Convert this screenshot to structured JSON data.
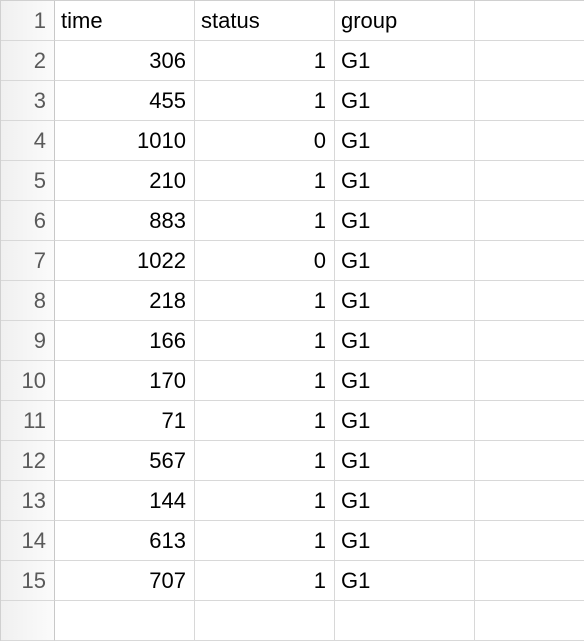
{
  "headers": {
    "col1": "time",
    "col2": "status",
    "col3": "group"
  },
  "rows": [
    {
      "n": "1",
      "time": "",
      "status": "",
      "group": ""
    },
    {
      "n": "2",
      "time": "306",
      "status": "1",
      "group": "G1"
    },
    {
      "n": "3",
      "time": "455",
      "status": "1",
      "group": "G1"
    },
    {
      "n": "4",
      "time": "1010",
      "status": "0",
      "group": "G1"
    },
    {
      "n": "5",
      "time": "210",
      "status": "1",
      "group": "G1"
    },
    {
      "n": "6",
      "time": "883",
      "status": "1",
      "group": "G1"
    },
    {
      "n": "7",
      "time": "1022",
      "status": "0",
      "group": "G1"
    },
    {
      "n": "8",
      "time": "218",
      "status": "1",
      "group": "G1"
    },
    {
      "n": "9",
      "time": "166",
      "status": "1",
      "group": "G1"
    },
    {
      "n": "10",
      "time": "170",
      "status": "1",
      "group": "G1"
    },
    {
      "n": "11",
      "time": "71",
      "status": "1",
      "group": "G1"
    },
    {
      "n": "12",
      "time": "567",
      "status": "1",
      "group": "G1"
    },
    {
      "n": "13",
      "time": "144",
      "status": "1",
      "group": "G1"
    },
    {
      "n": "14",
      "time": "613",
      "status": "1",
      "group": "G1"
    },
    {
      "n": "15",
      "time": "707",
      "status": "1",
      "group": "G1"
    }
  ],
  "chart_data": {
    "type": "table",
    "columns": [
      "time",
      "status",
      "group"
    ],
    "data": [
      [
        306,
        1,
        "G1"
      ],
      [
        455,
        1,
        "G1"
      ],
      [
        1010,
        0,
        "G1"
      ],
      [
        210,
        1,
        "G1"
      ],
      [
        883,
        1,
        "G1"
      ],
      [
        1022,
        0,
        "G1"
      ],
      [
        218,
        1,
        "G1"
      ],
      [
        166,
        1,
        "G1"
      ],
      [
        170,
        1,
        "G1"
      ],
      [
        71,
        1,
        "G1"
      ],
      [
        567,
        1,
        "G1"
      ],
      [
        144,
        1,
        "G1"
      ],
      [
        613,
        1,
        "G1"
      ],
      [
        707,
        1,
        "G1"
      ]
    ]
  }
}
